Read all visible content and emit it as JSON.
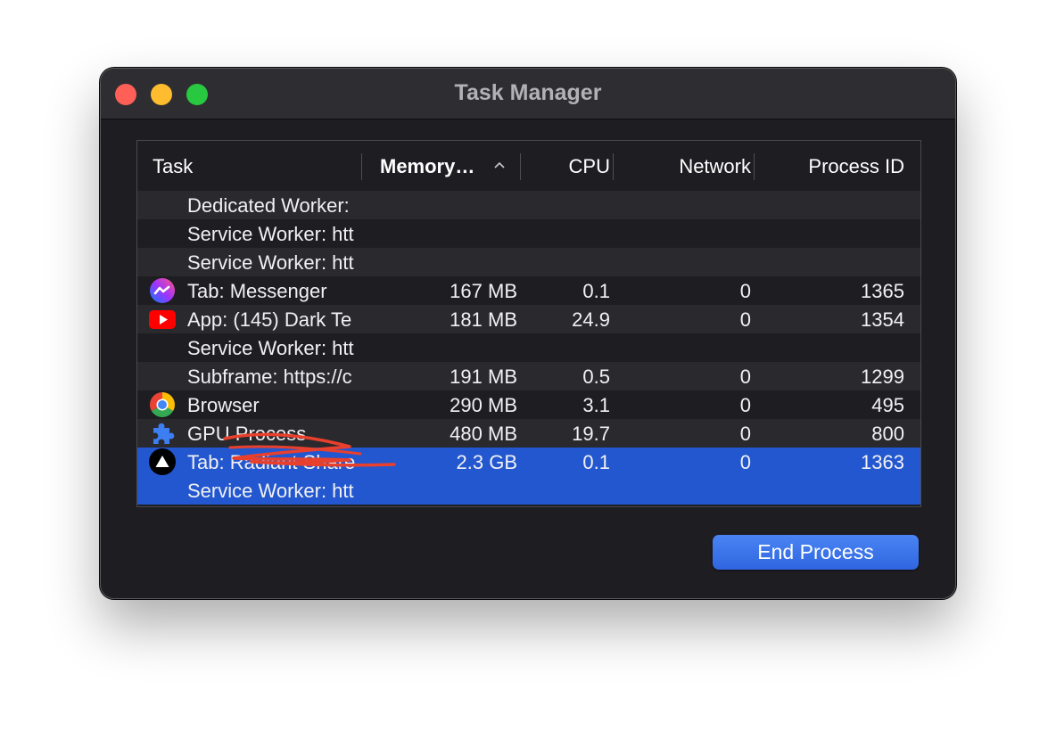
{
  "window": {
    "title": "Task Manager"
  },
  "columns": {
    "task": "Task",
    "memory": "Memory…",
    "cpu": "CPU",
    "network": "Network",
    "pid": "Process ID",
    "sorted_by": "memory",
    "sort_direction": "ascending"
  },
  "rows": [
    {
      "task": "Dedicated Worker:",
      "memory": "",
      "cpu": "",
      "network": "",
      "pid": "",
      "icon": ""
    },
    {
      "task": "Service Worker: htt",
      "memory": "",
      "cpu": "",
      "network": "",
      "pid": "",
      "icon": ""
    },
    {
      "task": "Service Worker: htt",
      "memory": "",
      "cpu": "",
      "network": "",
      "pid": "",
      "icon": ""
    },
    {
      "task": "Tab: Messenger",
      "memory": "167 MB",
      "cpu": "0.1",
      "network": "0",
      "pid": "1365",
      "icon": "messenger-icon"
    },
    {
      "task": "App: (145) Dark Te",
      "memory": "181 MB",
      "cpu": "24.9",
      "network": "0",
      "pid": "1354",
      "icon": "youtube-icon"
    },
    {
      "task": "Service Worker: htt",
      "memory": "",
      "cpu": "",
      "network": "",
      "pid": "",
      "icon": ""
    },
    {
      "task": "Subframe: https://c",
      "memory": "191 MB",
      "cpu": "0.5",
      "network": "0",
      "pid": "1299",
      "icon": ""
    },
    {
      "task": "Browser",
      "memory": "290 MB",
      "cpu": "3.1",
      "network": "0",
      "pid": "495",
      "icon": "chrome-icon"
    },
    {
      "task": "GPU Process",
      "memory": "480 MB",
      "cpu": "19.7",
      "network": "0",
      "pid": "800",
      "icon": "puzzle-icon"
    },
    {
      "task": "Tab: Radiant Share",
      "memory": "2.3 GB",
      "cpu": "0.1",
      "network": "0",
      "pid": "1363",
      "icon": "triangle-icon",
      "selected": true
    },
    {
      "task": "Service Worker: htt",
      "memory": "",
      "cpu": "",
      "network": "",
      "pid": "",
      "icon": "",
      "selected": true
    }
  ],
  "end_process_label": "End Process",
  "colors": {
    "window_bg": "#1e1d22",
    "titlebar": "#2e2d31",
    "selection": "#2257cf",
    "button": "#3a75ea",
    "scribble": "#e8402c"
  }
}
